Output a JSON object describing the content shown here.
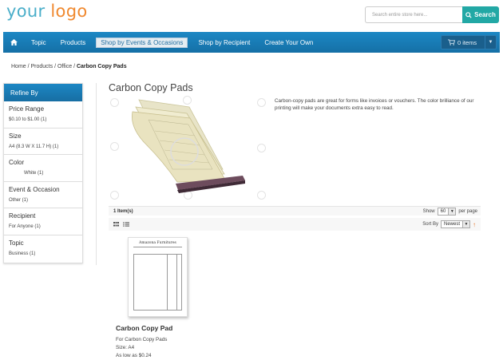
{
  "logo": {
    "part1": "your",
    "part2": "logo"
  },
  "search": {
    "placeholder": "Search entire store here...",
    "button": "Search"
  },
  "nav": {
    "items": [
      "Topic",
      "Products",
      "Shop by Events & Occasions",
      "Shop by Recipient",
      "Create Your Own"
    ],
    "cart_label": "0 items"
  },
  "breadcrumb": {
    "path": "Home / Products / Office / ",
    "current": "Carbon Copy Pads"
  },
  "sidebar": {
    "title": "Refine By",
    "facets": [
      {
        "title": "Price Range",
        "value": "$0.10 to $1.00 (1)"
      },
      {
        "title": "Size",
        "value": "A4 (8.3 W X 11.7 H) (1)"
      },
      {
        "title": "Color",
        "value": "White (1)"
      },
      {
        "title": "Event & Occasion",
        "value": "Other (1)"
      },
      {
        "title": "Recipient",
        "value": "For Anyone (1)"
      },
      {
        "title": "Topic",
        "value": "Business (1)"
      }
    ]
  },
  "category": {
    "title": "Carbon Copy Pads",
    "description": "Carbon-copy pads are great for forms like invoices or vouchers. The color brilliance of our printing will make your documents extra easy to read."
  },
  "toolbar": {
    "item_count": "1 Item(s)",
    "show_label": "Show",
    "show_value": "60",
    "per_page": "per page",
    "sort_label": "Sort By",
    "sort_value": "Newest"
  },
  "product": {
    "thumb_title": "Amazona Furnitures",
    "name": "Carbon Copy Pad",
    "line1": "For Carbon Copy Pads",
    "line2": "Size: A4",
    "line3": "As low as $0.24"
  },
  "colors": {
    "nav": "#1c87c4",
    "search_button": "#22a8a5",
    "logo_blue": "#4aaec9",
    "logo_orange": "#f0892f"
  }
}
